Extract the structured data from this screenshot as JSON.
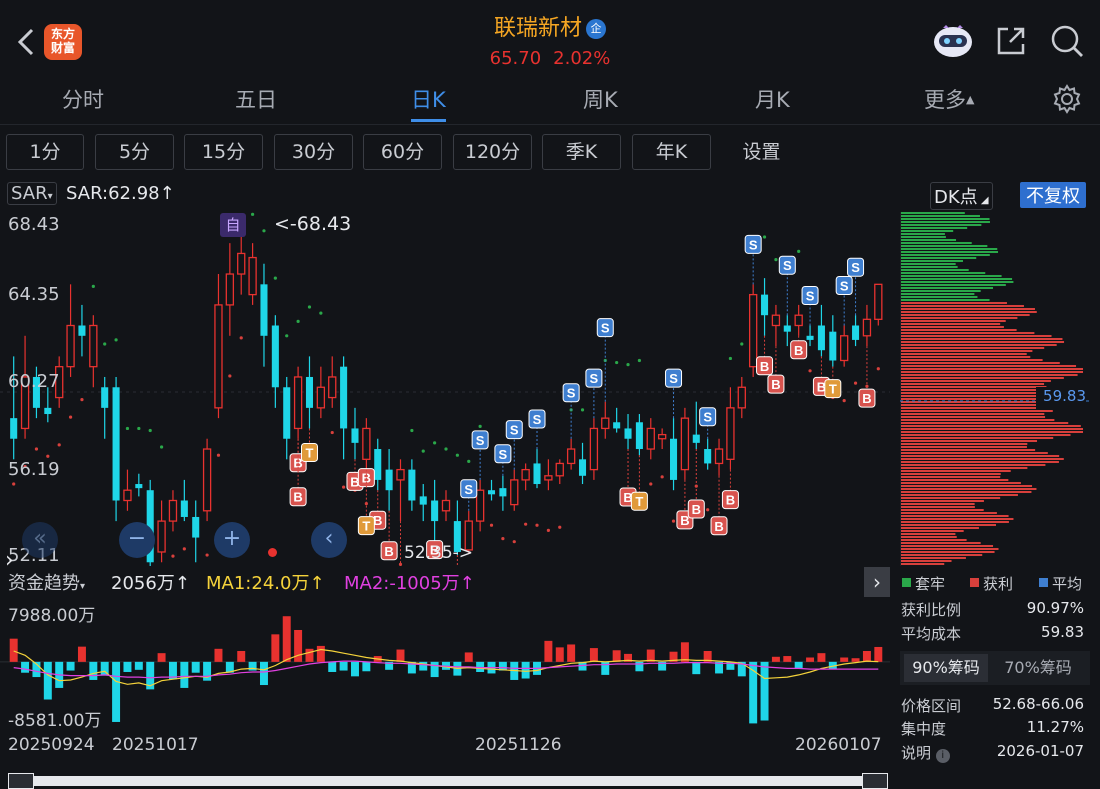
{
  "header": {
    "logo_line1": "东方",
    "logo_line2": "财富",
    "stock_name": "联瑞新材",
    "badge": "企",
    "price": "65.70",
    "change_pct": "2.02%"
  },
  "tabs": [
    "分时",
    "五日",
    "日K",
    "周K",
    "月K",
    "更多"
  ],
  "active_tab": "日K",
  "periods": [
    "1分",
    "5分",
    "15分",
    "30分",
    "60分",
    "120分",
    "季K",
    "年K",
    "设置"
  ],
  "indicator": {
    "selector": "SAR",
    "value_label": "SAR:62.98",
    "arrow": "↑",
    "dk_label": "DK点",
    "fuquan": "不复权"
  },
  "price_axis": [
    "68.43",
    "64.35",
    "60.27",
    "56.19",
    "52.11"
  ],
  "annotations": {
    "zi": "自",
    "high_label": "<-68.43",
    "low_label": "52.35->",
    "avg_cost_tag": "59.83"
  },
  "fund": {
    "title": "资金趋势",
    "value": "2056万",
    "ma1": "MA1:24.0万",
    "ma2": "MA2:-1005万",
    "up_arrow": "↑",
    "top": "7988.00万",
    "bottom": "-8581.00万"
  },
  "dates": [
    "20250924",
    "20251017",
    "20251126",
    "20260107"
  ],
  "chip": {
    "legend": [
      "套牢",
      "获利",
      "平均"
    ],
    "legend_colors": [
      "#2aa84a",
      "#d8403c",
      "#3f7fd0"
    ],
    "rows": [
      {
        "label": "获利比例",
        "value": "90.97%"
      },
      {
        "label": "平均成本",
        "value": "59.83"
      }
    ],
    "tab_90": "90%筹码",
    "tab_70": "70%筹码",
    "rows2": [
      {
        "label": "价格区间",
        "value": "52.68-66.06"
      },
      {
        "label": "集中度",
        "value": "11.27%"
      },
      {
        "label": "说明",
        "value": "2026-01-07"
      }
    ]
  },
  "colors": {
    "up": "#e8322f",
    "down": "#1fd6e8",
    "accent": "#3f8ee8",
    "gold": "#f5a623"
  },
  "candles": [
    {
      "o": 59,
      "h": 62,
      "l": 57,
      "c": 58
    },
    {
      "o": 58.5,
      "h": 63,
      "l": 58,
      "c": 61
    },
    {
      "o": 61,
      "h": 61.5,
      "l": 59,
      "c": 59.5
    },
    {
      "o": 59.5,
      "h": 60.5,
      "l": 58.8,
      "c": 59.2
    },
    {
      "o": 60,
      "h": 62,
      "l": 59.5,
      "c": 61.5
    },
    {
      "o": 61.5,
      "h": 65.5,
      "l": 61,
      "c": 63.5
    },
    {
      "o": 63.5,
      "h": 64.5,
      "l": 62,
      "c": 63
    },
    {
      "o": 61.5,
      "h": 64,
      "l": 60.5,
      "c": 63.5
    },
    {
      "o": 60.5,
      "h": 61,
      "l": 58,
      "c": 59.5
    },
    {
      "o": 60.5,
      "h": 61,
      "l": 54,
      "c": 55
    },
    {
      "o": 55,
      "h": 56.5,
      "l": 54.5,
      "c": 55.5
    },
    {
      "o": 55.8,
      "h": 56.3,
      "l": 55.2,
      "c": 55.6
    },
    {
      "o": 55.5,
      "h": 56,
      "l": 50.5,
      "c": 52
    },
    {
      "o": 52.5,
      "h": 55,
      "l": 52,
      "c": 54
    },
    {
      "o": 54,
      "h": 55.5,
      "l": 53.5,
      "c": 55
    },
    {
      "o": 55,
      "h": 56,
      "l": 54,
      "c": 54.2
    },
    {
      "o": 54.2,
      "h": 55,
      "l": 52,
      "c": 53.2
    },
    {
      "o": 54.5,
      "h": 58,
      "l": 54,
      "c": 57.5
    },
    {
      "o": 59.5,
      "h": 66,
      "l": 59,
      "c": 64.5
    },
    {
      "o": 64.5,
      "h": 67.5,
      "l": 63,
      "c": 66
    },
    {
      "o": 66,
      "h": 68.43,
      "l": 65,
      "c": 67
    },
    {
      "o": 65,
      "h": 67.5,
      "l": 64.5,
      "c": 66.8
    },
    {
      "o": 65.5,
      "h": 66.5,
      "l": 61.5,
      "c": 63
    },
    {
      "o": 63.5,
      "h": 64,
      "l": 59.5,
      "c": 60.5
    },
    {
      "o": 60.5,
      "h": 61,
      "l": 57,
      "c": 58
    },
    {
      "o": 58.5,
      "h": 61.5,
      "l": 58,
      "c": 61
    },
    {
      "o": 61,
      "h": 62,
      "l": 58.5,
      "c": 59.5
    },
    {
      "o": 59.5,
      "h": 61.5,
      "l": 59,
      "c": 60.5
    },
    {
      "o": 60,
      "h": 62,
      "l": 59.5,
      "c": 61
    },
    {
      "o": 61.5,
      "h": 62,
      "l": 57,
      "c": 58.5
    },
    {
      "o": 58.5,
      "h": 59.5,
      "l": 57,
      "c": 57.8
    },
    {
      "o": 57,
      "h": 59,
      "l": 56.5,
      "c": 58.5
    },
    {
      "o": 57.5,
      "h": 58,
      "l": 55.5,
      "c": 56
    },
    {
      "o": 56.5,
      "h": 57.5,
      "l": 54.5,
      "c": 55.5
    },
    {
      "o": 56,
      "h": 57,
      "l": 54,
      "c": 56.5
    },
    {
      "o": 56.5,
      "h": 57,
      "l": 54.5,
      "c": 55
    },
    {
      "o": 55.2,
      "h": 55.8,
      "l": 54,
      "c": 54.8
    },
    {
      "o": 55,
      "h": 56,
      "l": 53,
      "c": 54
    },
    {
      "o": 54.5,
      "h": 55.5,
      "l": 54,
      "c": 55
    },
    {
      "o": 54,
      "h": 55,
      "l": 52.35,
      "c": 52.5
    },
    {
      "o": 52.6,
      "h": 54.5,
      "l": 52.4,
      "c": 54
    },
    {
      "o": 54,
      "h": 56,
      "l": 53.5,
      "c": 55.5
    },
    {
      "o": 55.5,
      "h": 56,
      "l": 55,
      "c": 55.3
    },
    {
      "o": 55.6,
      "h": 56.2,
      "l": 54.5,
      "c": 55.2
    },
    {
      "o": 54.8,
      "h": 56.5,
      "l": 54.5,
      "c": 56
    },
    {
      "o": 56,
      "h": 56.8,
      "l": 55.5,
      "c": 56.5
    },
    {
      "o": 56.8,
      "h": 57.5,
      "l": 55.6,
      "c": 55.8
    },
    {
      "o": 56,
      "h": 57,
      "l": 55.5,
      "c": 56.2
    },
    {
      "o": 56.2,
      "h": 57,
      "l": 55.8,
      "c": 56.8
    },
    {
      "o": 56.8,
      "h": 58,
      "l": 56.5,
      "c": 57.5
    },
    {
      "o": 57,
      "h": 57.8,
      "l": 55.8,
      "c": 56.2
    },
    {
      "o": 56.5,
      "h": 59,
      "l": 56,
      "c": 58.5
    },
    {
      "o": 58.5,
      "h": 59.8,
      "l": 58,
      "c": 59
    },
    {
      "o": 58.8,
      "h": 59.5,
      "l": 58.3,
      "c": 58.5
    },
    {
      "o": 58.5,
      "h": 59.2,
      "l": 57.5,
      "c": 58
    },
    {
      "o": 58.8,
      "h": 59.2,
      "l": 57.2,
      "c": 57.5
    },
    {
      "o": 57.5,
      "h": 59,
      "l": 57,
      "c": 58.5
    },
    {
      "o": 58,
      "h": 58.5,
      "l": 57.5,
      "c": 58.2
    },
    {
      "o": 58,
      "h": 59,
      "l": 55.5,
      "c": 56
    },
    {
      "o": 56.5,
      "h": 59.5,
      "l": 56,
      "c": 59
    },
    {
      "o": 58.2,
      "h": 59.8,
      "l": 57.5,
      "c": 57.8
    },
    {
      "o": 57.5,
      "h": 58,
      "l": 56.5,
      "c": 56.8
    },
    {
      "o": 56.8,
      "h": 58,
      "l": 56.2,
      "c": 57.5
    },
    {
      "o": 57,
      "h": 60.5,
      "l": 56.5,
      "c": 59.5
    },
    {
      "o": 59.5,
      "h": 61,
      "l": 59,
      "c": 60.5
    },
    {
      "o": 61.5,
      "h": 65.5,
      "l": 61,
      "c": 65
    },
    {
      "o": 65,
      "h": 65.8,
      "l": 63,
      "c": 64
    },
    {
      "o": 63.5,
      "h": 64.5,
      "l": 62.5,
      "c": 64
    },
    {
      "o": 63.5,
      "h": 64,
      "l": 62.5,
      "c": 63.2
    },
    {
      "o": 63.5,
      "h": 64.5,
      "l": 63,
      "c": 64
    },
    {
      "o": 63,
      "h": 63.5,
      "l": 62.5,
      "c": 62.8
    },
    {
      "o": 63.5,
      "h": 64.5,
      "l": 62,
      "c": 62.3
    },
    {
      "o": 63.2,
      "h": 64,
      "l": 61.5,
      "c": 61.8
    },
    {
      "o": 61.8,
      "h": 63.5,
      "l": 61.5,
      "c": 63
    },
    {
      "o": 63.5,
      "h": 64,
      "l": 62.5,
      "c": 62.8
    },
    {
      "o": 63,
      "h": 64.5,
      "l": 62.5,
      "c": 63.8
    },
    {
      "o": 63.8,
      "h": 65.5,
      "l": 63.5,
      "c": 65.5
    }
  ],
  "fund_flows": [
    3200,
    -1500,
    -2100,
    -5200,
    -3600,
    -1200,
    2100,
    -2500,
    -1900,
    -8300,
    -1400,
    -1100,
    -3800,
    1200,
    -2400,
    -3600,
    -1500,
    -2600,
    1800,
    -1500,
    1500,
    -1200,
    -3200,
    3800,
    6300,
    4400,
    1800,
    2200,
    -1400,
    -1200,
    -2000,
    -1300,
    800,
    -1100,
    1700,
    -1600,
    -1200,
    -2100,
    -1100,
    -1900,
    1300,
    -1400,
    -1600,
    -1200,
    -2500,
    -2300,
    -1800,
    2900,
    2000,
    2400,
    -1200,
    1900,
    -1800,
    1600,
    1100,
    -1300,
    1700,
    -1200,
    1400,
    2700,
    -1700,
    1500,
    -1600,
    -1100,
    -2000,
    -8500,
    -8100,
    700,
    800,
    -900,
    600,
    1200,
    -1000,
    600,
    500,
    1500,
    2056
  ],
  "fund_ma1": [
    1500,
    900,
    -300,
    -1800,
    -2600,
    -2500,
    -2100,
    -1600,
    -1300,
    -2700,
    -3100,
    -2900,
    -3300,
    -2600,
    -2400,
    -2200,
    -2000,
    -2100,
    -1600,
    -1400,
    -1000,
    -900,
    -1100,
    -500,
    300,
    900,
    1300,
    1700,
    1500,
    1200,
    900,
    600,
    400,
    200,
    100,
    -100,
    -300,
    -500,
    -700,
    -900,
    -800,
    -900,
    -1000,
    -1100,
    -1200,
    -1300,
    -1200,
    -800,
    -500,
    -200,
    -100,
    100,
    0,
    100,
    200,
    100,
    200,
    100,
    200,
    300,
    200,
    200,
    100,
    0,
    -200,
    -1200,
    -2300,
    -2200,
    -2100,
    -1800,
    -1400,
    -900,
    -600,
    -300,
    -100,
    100,
    24
  ],
  "fund_ma2": [
    -800,
    -1000,
    -1300,
    -1600,
    -1800,
    -1900,
    -1900,
    -1900,
    -1800,
    -2000,
    -2100,
    -2100,
    -2200,
    -2100,
    -2100,
    -2000,
    -2000,
    -2000,
    -1800,
    -1700,
    -1500,
    -1400,
    -1400,
    -1200,
    -900,
    -600,
    -300,
    -100,
    0,
    100,
    100,
    0,
    -100,
    -200,
    -200,
    -300,
    -400,
    -500,
    -600,
    -700,
    -700,
    -800,
    -800,
    -800,
    -900,
    -900,
    -900,
    -800,
    -700,
    -600,
    -500,
    -400,
    -400,
    -300,
    -300,
    -300,
    -200,
    -200,
    -200,
    -100,
    -100,
    -100,
    -200,
    -200,
    -300,
    -500,
    -700,
    -800,
    -900,
    -900,
    -1000,
    -1000,
    -1000,
    -1000,
    -1000,
    -1000,
    -1005
  ]
}
